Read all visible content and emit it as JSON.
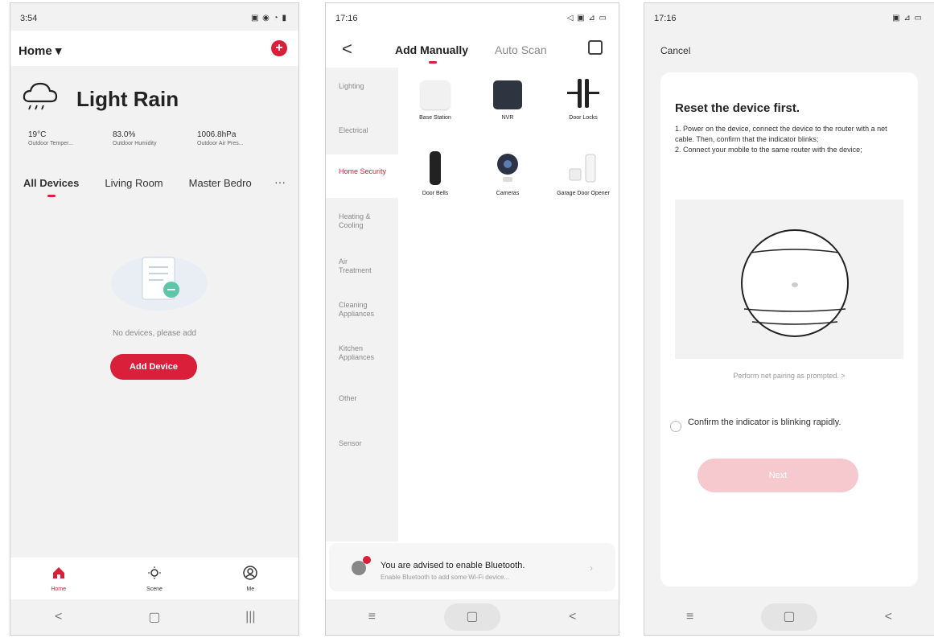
{
  "screen1": {
    "status": {
      "time": "3:54",
      "icons": "▣ ◉ ◔ ▮"
    },
    "home_title": "Home ▾",
    "weather": {
      "condition": "Light Rain"
    },
    "stats": [
      {
        "value": "19°C",
        "label": "Outdoor Temper..."
      },
      {
        "value": "83.0%",
        "label": "Outdoor Humidity"
      },
      {
        "value": "1006.8hPa",
        "label": "Outdoor Air Pres..."
      }
    ],
    "tabs": [
      "All Devices",
      "Living Room",
      "Master Bedro"
    ],
    "more": "···",
    "empty_text": "No devices, please add",
    "add_device": "Add Device",
    "bottom_nav": [
      {
        "icon": "home-icon",
        "label": "Home"
      },
      {
        "icon": "scene-icon",
        "label": "Scene"
      },
      {
        "icon": "me-icon",
        "label": "Me"
      }
    ],
    "system_nav": [
      "<",
      "▢",
      "|||"
    ]
  },
  "screen2": {
    "status": {
      "time": "17:16",
      "icons": "◁ ▣ ⊿ ▭"
    },
    "back": "<",
    "tab_manual": "Add Manually",
    "tab_auto": "Auto Scan",
    "categories": [
      "Lighting",
      "Electrical",
      "Home Security",
      "Heating & Cooling",
      "Air Treatment",
      "Cleaning Appliances",
      "Kitchen Appliances",
      "Other",
      "Sensor"
    ],
    "active_category": "Home Security",
    "devices": [
      "Base Station",
      "NVR",
      "Door Locks",
      "Door Bells",
      "Cameras",
      "Garage Door Opener"
    ],
    "bluetooth": {
      "title": "You are advised to enable Bluetooth.",
      "subtitle": "Enable Bluetooth to add some Wi-Fi device..."
    },
    "system_nav": [
      "≡",
      "▢",
      "<"
    ]
  },
  "screen3": {
    "status": {
      "time": "17:16",
      "icons": "▣ ⊿ ▭"
    },
    "cancel": "Cancel",
    "title": "Reset the device first.",
    "step1": "1. Power on the device, connect the device to the router with a net cable. Then, confirm that the indicator blinks;",
    "step2": "2. Connect your mobile to the same router with the device;",
    "prompt": "Perform net pairing as prompted. >",
    "confirm": "Confirm the indicator is blinking rapidly.",
    "next": "Next",
    "system_nav": [
      "≡",
      "▢",
      "<"
    ]
  },
  "colors": {
    "accent": "#d91f3a",
    "next_disabled": "#f6c9cf",
    "background": "#f2f2f2"
  }
}
